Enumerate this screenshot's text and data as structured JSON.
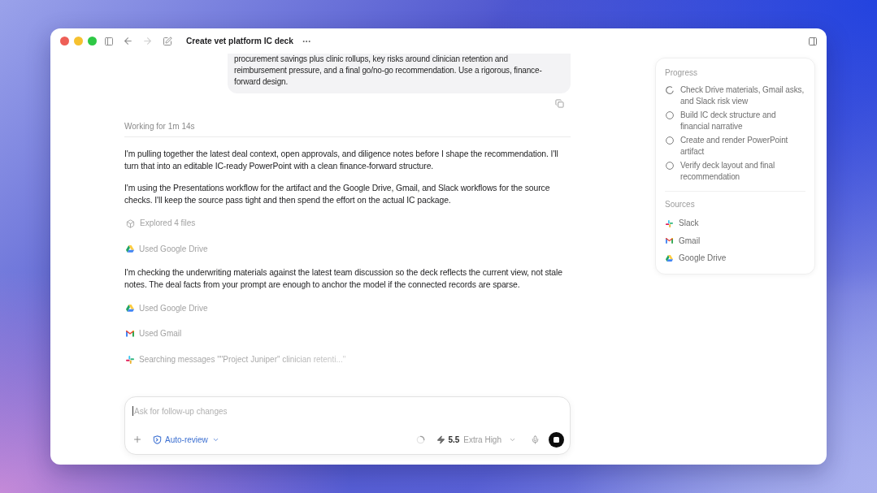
{
  "window": {
    "title": "Create vet platform IC deck"
  },
  "navigation": {
    "back_disabled": false,
    "forward_disabled": true
  },
  "user_message": {
    "text": "procurement savings plus clinic rollups, key risks around clinician retention and reimbursement pressure, and a final go/no-go recommendation. Use a rigorous, finance-forward design."
  },
  "status": "Working for 1m 14s",
  "transcript": [
    {
      "kind": "paragraph",
      "text": "I'm pulling together the latest deal context, open approvals, and diligence notes before I shape the recommendation. I'll turn that into an editable IC-ready PowerPoint with a clean finance-forward structure."
    },
    {
      "kind": "paragraph",
      "text": "I'm using the Presentations workflow for the artifact and the Google Drive, Gmail, and Slack workflows for the source checks. I'll keep the source pass tight and then spend the effort on the actual IC package."
    },
    {
      "kind": "files",
      "text": "Explored 4 files",
      "in_progress": false
    },
    {
      "kind": "drive",
      "text": "Used Google Drive",
      "in_progress": false
    },
    {
      "kind": "paragraph",
      "text": "I'm checking the underwriting materials against the latest team discussion so the deck reflects the current view, not stale notes. The deal facts from your prompt are enough to anchor the model if the connected records are sparse."
    },
    {
      "kind": "drive",
      "text": "Used Google Drive",
      "in_progress": false
    },
    {
      "kind": "gmail",
      "text": "Used Gmail",
      "in_progress": false
    },
    {
      "kind": "slack",
      "text": "Searching messages \"\"Project Juniper\" clinician retenti...\"",
      "in_progress": true
    }
  ],
  "composer": {
    "placeholder": "Ask for follow-up changes",
    "mode": "Auto-review",
    "model": "5.5",
    "effort": "Extra High",
    "running": true
  },
  "progress": {
    "title": "Progress",
    "steps": [
      {
        "text": "Check Drive materials, Gmail asks, and Slack risk view",
        "in_progress": true
      },
      {
        "text": "Build IC deck structure and financial narrative",
        "in_progress": false
      },
      {
        "text": "Create and render PowerPoint artifact",
        "in_progress": false
      },
      {
        "text": "Verify deck layout and final recommendation",
        "in_progress": false
      }
    ]
  },
  "sources": {
    "title": "Sources",
    "items": [
      {
        "kind": "slack",
        "label": "Slack"
      },
      {
        "kind": "gmail",
        "label": "Gmail"
      },
      {
        "kind": "drive",
        "label": "Google Drive"
      }
    ]
  }
}
